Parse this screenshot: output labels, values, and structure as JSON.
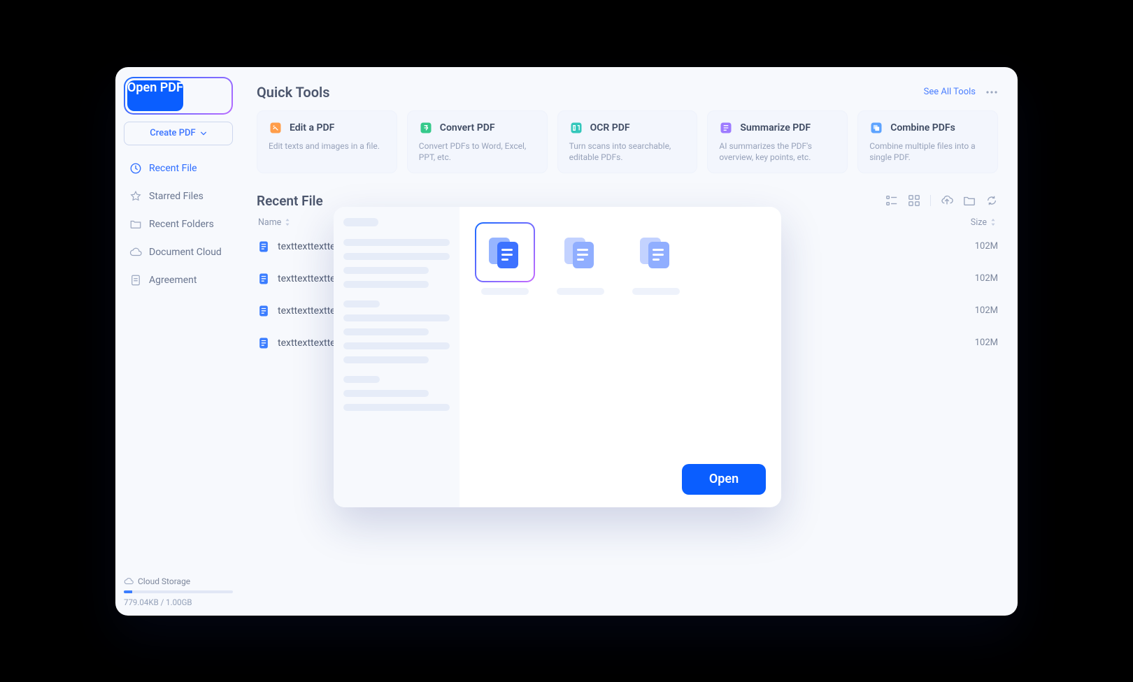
{
  "sidebar": {
    "open_pdf_label": "Open PDF",
    "create_pdf_label": "Create PDF",
    "nav": [
      {
        "label": "Recent File",
        "icon": "clock-icon",
        "active": true
      },
      {
        "label": "Starred Files",
        "icon": "star-icon",
        "active": false
      },
      {
        "label": "Recent Folders",
        "icon": "folder-icon",
        "active": false
      },
      {
        "label": "Document Cloud",
        "icon": "cloud-icon",
        "active": false
      },
      {
        "label": "Agreement",
        "icon": "agreement-icon",
        "active": false
      }
    ],
    "cloud": {
      "title": "Cloud Storage",
      "usage_text": "779.04KB / 1.00GB",
      "usage_fraction": 0.08
    }
  },
  "header": {
    "title": "Quick Tools",
    "see_all_label": "See All Tools"
  },
  "tools": [
    {
      "title": "Edit a PDF",
      "desc": "Edit texts and images in a file.",
      "color": "#ff9d4a"
    },
    {
      "title": "Convert PDF",
      "desc": "Convert PDFs to Word, Excel, PPT, etc.",
      "color": "#35c98b"
    },
    {
      "title": "OCR PDF",
      "desc": "Turn scans into searchable, editable PDFs.",
      "color": "#34c7bb"
    },
    {
      "title": "Summarize PDF",
      "desc": "AI summarizes the PDF's overview, key points, etc.",
      "color": "#9d7bff"
    },
    {
      "title": "Combine PDFs",
      "desc": "Combine multiple files into a single PDF.",
      "color": "#5da3ff"
    }
  ],
  "recent": {
    "title": "Recent File",
    "columns": {
      "name": "Name",
      "size": "Size"
    },
    "rows": [
      {
        "name": "texttexttexttext",
        "size": "102M"
      },
      {
        "name": "texttexttexttext",
        "size": "102M"
      },
      {
        "name": "texttexttexttext",
        "size": "102M"
      },
      {
        "name": "texttexttexttext",
        "size": "102M"
      }
    ]
  },
  "modal": {
    "open_label": "Open",
    "thumbs": [
      {
        "selected": true
      },
      {
        "selected": false
      },
      {
        "selected": false
      }
    ]
  }
}
